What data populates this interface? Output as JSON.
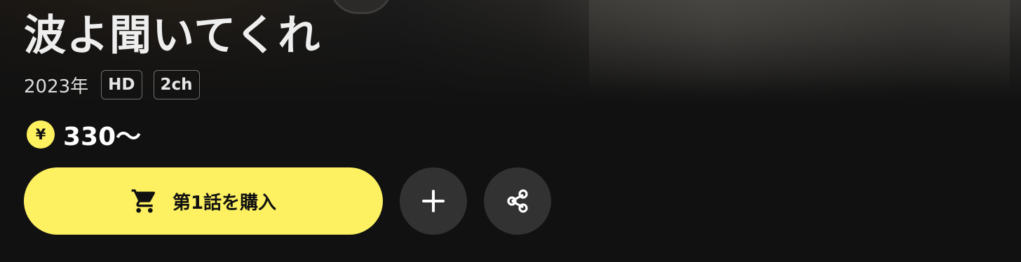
{
  "title": "波よ聞いてくれ",
  "meta": {
    "year": "2023年",
    "badges": [
      "HD",
      "2ch"
    ]
  },
  "price": {
    "currency_symbol": "¥",
    "value": "330〜"
  },
  "actions": {
    "buy_label": "第1話を購入",
    "buy_icon": "cart-icon",
    "add_icon": "plus-icon",
    "share_icon": "share-icon"
  },
  "colors": {
    "accent": "#fdf061",
    "background": "#111111",
    "circle_button": "#323232"
  }
}
